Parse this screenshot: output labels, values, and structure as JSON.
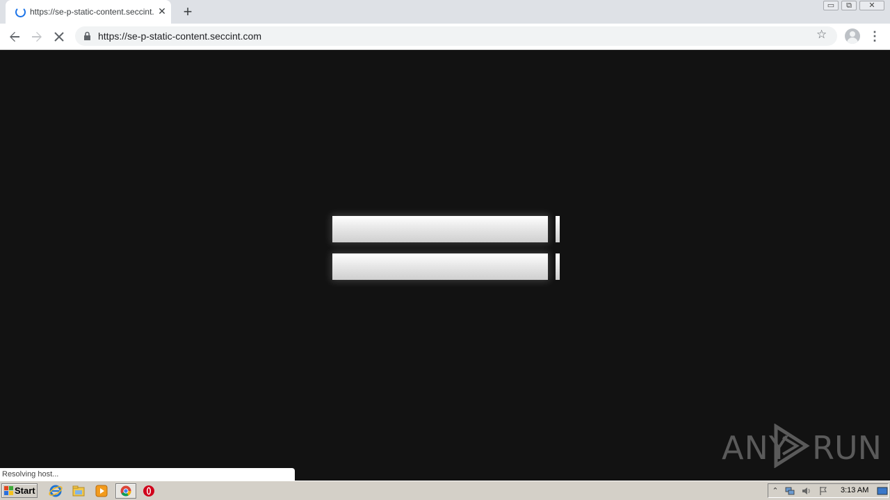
{
  "browser": {
    "tab_title": "https://se-p-static-content.seccint.c",
    "tab_close": "✕",
    "new_tab": "+",
    "url": "https://se-p-static-content.seccint.com",
    "window_controls": {
      "minimize": "▭",
      "maximize": "⧉",
      "close": "✕"
    },
    "icons": {
      "back": "back-arrow-icon",
      "forward": "forward-arrow-icon",
      "stop": "stop-loading-icon",
      "lock": "lock-icon",
      "star": "bookmark-star-icon",
      "profile": "profile-avatar-icon",
      "menu": "kebab-menu-icon"
    }
  },
  "page": {
    "background": "#121212",
    "watermark": {
      "left": "ANY",
      "right": "RUN"
    }
  },
  "status_bar": {
    "text": "Resolving host..."
  },
  "taskbar": {
    "start_label": "Start",
    "pinned": [
      "internet-explorer-icon",
      "windows-explorer-icon",
      "media-player-icon",
      "chrome-icon",
      "opera-icon"
    ],
    "clock": "3:13 AM"
  }
}
